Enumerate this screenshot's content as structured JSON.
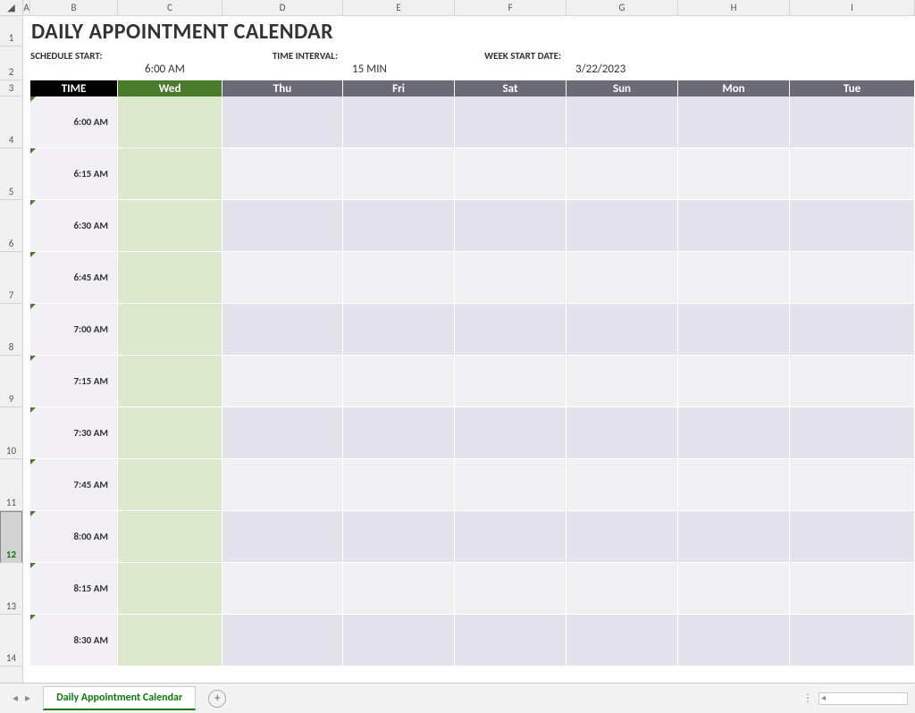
{
  "columns": [
    "A",
    "B",
    "C",
    "D",
    "E",
    "F",
    "G",
    "H",
    "I"
  ],
  "rows": [
    "1",
    "2",
    "3",
    "4",
    "5",
    "6",
    "7",
    "8",
    "9",
    "10",
    "11",
    "12",
    "13",
    "14"
  ],
  "selected_row": "12",
  "title": "DAILY APPOINTMENT CALENDAR",
  "settings": {
    "schedule_start_label": "SCHEDULE START:",
    "schedule_start_value": "6:00 AM",
    "time_interval_label": "TIME INTERVAL:",
    "time_interval_value": "15 MIN",
    "week_start_label": "WEEK START DATE:",
    "week_start_value": "3/22/2023"
  },
  "headers": {
    "time": "TIME",
    "days": [
      "Wed",
      "Thu",
      "Fri",
      "Sat",
      "Sun",
      "Mon",
      "Tue"
    ]
  },
  "times": [
    "6:00 AM",
    "6:15 AM",
    "6:30 AM",
    "6:45 AM",
    "7:00 AM",
    "7:15 AM",
    "7:30 AM",
    "7:45 AM",
    "8:00 AM",
    "8:15 AM",
    "8:30 AM"
  ],
  "tab": {
    "name": "Daily Appointment Calendar"
  },
  "chart_data": {
    "type": "table",
    "title": "Daily Appointment Calendar",
    "columns": [
      "TIME",
      "Wed",
      "Thu",
      "Fri",
      "Sat",
      "Sun",
      "Mon",
      "Tue"
    ],
    "rows": [
      [
        "6:00 AM",
        "",
        "",
        "",
        "",
        "",
        "",
        ""
      ],
      [
        "6:15 AM",
        "",
        "",
        "",
        "",
        "",
        "",
        ""
      ],
      [
        "6:30 AM",
        "",
        "",
        "",
        "",
        "",
        "",
        ""
      ],
      [
        "6:45 AM",
        "",
        "",
        "",
        "",
        "",
        "",
        ""
      ],
      [
        "7:00 AM",
        "",
        "",
        "",
        "",
        "",
        "",
        ""
      ],
      [
        "7:15 AM",
        "",
        "",
        "",
        "",
        "",
        "",
        ""
      ],
      [
        "7:30 AM",
        "",
        "",
        "",
        "",
        "",
        "",
        ""
      ],
      [
        "7:45 AM",
        "",
        "",
        "",
        "",
        "",
        "",
        ""
      ],
      [
        "8:00 AM",
        "",
        "",
        "",
        "",
        "",
        "",
        ""
      ],
      [
        "8:15 AM",
        "",
        "",
        "",
        "",
        "",
        "",
        ""
      ],
      [
        "8:30 AM",
        "",
        "",
        "",
        "",
        "",
        "",
        ""
      ]
    ]
  }
}
